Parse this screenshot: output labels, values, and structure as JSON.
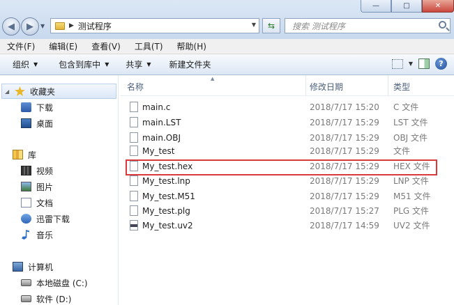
{
  "window": {
    "controls": [
      "—",
      "□",
      "✕"
    ]
  },
  "address": {
    "path": "测试程序",
    "search_placeholder": "搜索 测试程序"
  },
  "menu": [
    {
      "label": "文件(F)"
    },
    {
      "label": "编辑(E)"
    },
    {
      "label": "查看(V)"
    },
    {
      "label": "工具(T)"
    },
    {
      "label": "帮助(H)"
    }
  ],
  "toolbar": {
    "organize": "组织",
    "include_library": "包含到库中",
    "share": "共享",
    "new_folder": "新建文件夹"
  },
  "nav": {
    "favorites": "收藏夹",
    "downloads": "下载",
    "desktop": "桌面",
    "libraries": "库",
    "videos": "视频",
    "pictures": "图片",
    "documents": "文档",
    "thunder": "迅雷下载",
    "music": "音乐",
    "computer": "计算机",
    "local_disk_c": "本地磁盘 (C:)",
    "soft_d": "软件 (D:)"
  },
  "columns": {
    "name": "名称",
    "modified": "修改日期",
    "type": "类型"
  },
  "files": [
    {
      "name": "main.c",
      "date": "2018/7/17 15:20",
      "type": "C 文件"
    },
    {
      "name": "main.LST",
      "date": "2018/7/17 15:29",
      "type": "LST 文件"
    },
    {
      "name": "main.OBJ",
      "date": "2018/7/17 15:29",
      "type": "OBJ 文件"
    },
    {
      "name": "My_test",
      "date": "2018/7/17 15:29",
      "type": "文件"
    },
    {
      "name": "My_test.hex",
      "date": "2018/7/17 15:29",
      "type": "HEX 文件"
    },
    {
      "name": "My_test.lnp",
      "date": "2018/7/17 15:29",
      "type": "LNP 文件"
    },
    {
      "name": "My_test.M51",
      "date": "2018/7/17 15:29",
      "type": "M51 文件"
    },
    {
      "name": "My_test.plg",
      "date": "2018/7/17 15:27",
      "type": "PLG 文件"
    },
    {
      "name": "My_test.uv2",
      "date": "2018/7/17 14:59",
      "type": "UV2 文件"
    }
  ],
  "colors": {
    "highlight_border": "#d9393a"
  }
}
